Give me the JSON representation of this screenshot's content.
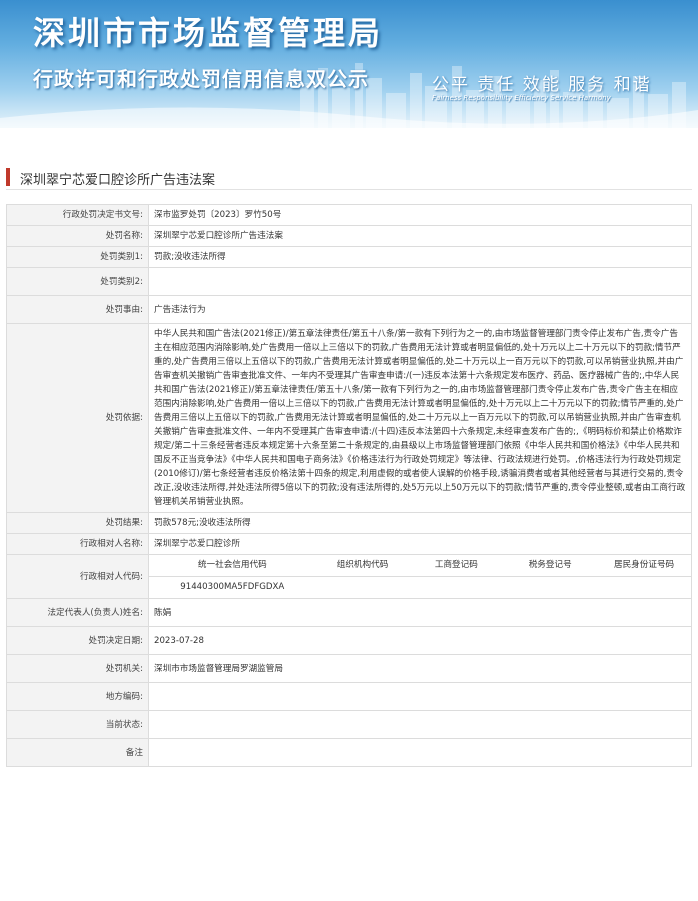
{
  "banner": {
    "title": "深圳市市场监督管理局",
    "subtitle": "行政许可和行政处罚信用信息双公示",
    "slogan": "公平 责任 效能 服务 和谐",
    "slogan_en": "Fairness  Responsibility  Efficiency  Service  Harmony"
  },
  "case_title": "深圳翠宁芯爱口腔诊所广告违法案",
  "rows": [
    {
      "label": "行政处罚决定书文号:",
      "value": "深市监罗处罚〔2023〕罗竹50号"
    },
    {
      "label": "处罚名称:",
      "value": "深圳翠宁芯爱口腔诊所广告违法案"
    },
    {
      "label": "处罚类别1:",
      "value": "罚款;没收违法所得"
    },
    {
      "label": "处罚类别2:",
      "value": ""
    },
    {
      "label": "处罚事由:",
      "value": "广告违法行为"
    },
    {
      "label": "处罚依据:",
      "value": "中华人民共和国广告法(2021修正)/第五章法律责任/第五十八条/第一款有下列行为之一的,由市场监督管理部门责令停止发布广告,责令广告主在相应范围内消除影响,处广告费用一倍以上三倍以下的罚款,广告费用无法计算或者明显偏低的,处十万元以上二十万元以下的罚款;情节严重的,处广告费用三倍以上五倍以下的罚款,广告费用无法计算或者明显偏低的,处二十万元以上一百万元以下的罚款,可以吊销营业执照,并由广告审查机关撤销广告审查批准文件、一年内不受理其广告审查申请:/(一)违反本法第十六条规定发布医疗、药品、医疗器械广告的;,中华人民共和国广告法(2021修正)/第五章法律责任/第五十八条/第一款有下列行为之一的,由市场监督管理部门责令停止发布广告,责令广告主在相应范围内消除影响,处广告费用一倍以上三倍以下的罚款,广告费用无法计算或者明显偏低的,处十万元以上二十万元以下的罚款;情节严重的,处广告费用三倍以上五倍以下的罚款,广告费用无法计算或者明显偏低的,处二十万元以上一百万元以下的罚款,可以吊销营业执照,并由广告审查机关撤销广告审查批准文件、一年内不受理其广告审查申请:/(十四)违反本法第四十六条规定,未经审查发布广告的;,《明码标价和禁止价格欺诈规定/第二十三条经营者违反本规定第十六条至第二十条规定的,由县级以上市场监督管理部门依照《中华人民共和国价格法》《中华人民共和国反不正当竞争法》《中华人民共和国电子商务法》《价格违法行为行政处罚规定》等法律、行政法规进行处罚。,价格违法行为行政处罚规定(2010修订)/第七条经营者违反价格法第十四条的规定,利用虚假的或者使人误解的价格手段,诱骗消费者或者其他经营者与其进行交易的,责令改正,没收违法所得,并处违法所得5倍以下的罚款;没有违法所得的,处5万元以上50万元以下的罚款;情节严重的,责令停业整顿,或者由工商行政管理机关吊销营业执照。"
    },
    {
      "label": "处罚结果:",
      "value": "罚款578元;没收违法所得"
    },
    {
      "label": "行政相对人名称:",
      "value": "深圳翠宁芯爱口腔诊所"
    }
  ],
  "code_row": {
    "label": "行政相对人代码:",
    "headers": [
      "统一社会信用代码",
      "组织机构代码",
      "工商登记码",
      "税务登记号",
      "居民身份证号码"
    ],
    "values": [
      "91440300MA5FDFGDXA",
      "",
      "",
      "",
      ""
    ]
  },
  "rows2": [
    {
      "label": "法定代表人(负责人)姓名:",
      "value": "陈娟"
    },
    {
      "label": "处罚决定日期:",
      "value": "2023-07-28"
    },
    {
      "label": "处罚机关:",
      "value": "深圳市市场监督管理局罗湖监管局"
    },
    {
      "label": "地方编码:",
      "value": ""
    },
    {
      "label": "当前状态:",
      "value": ""
    },
    {
      "label": "备注",
      "value": ""
    }
  ]
}
